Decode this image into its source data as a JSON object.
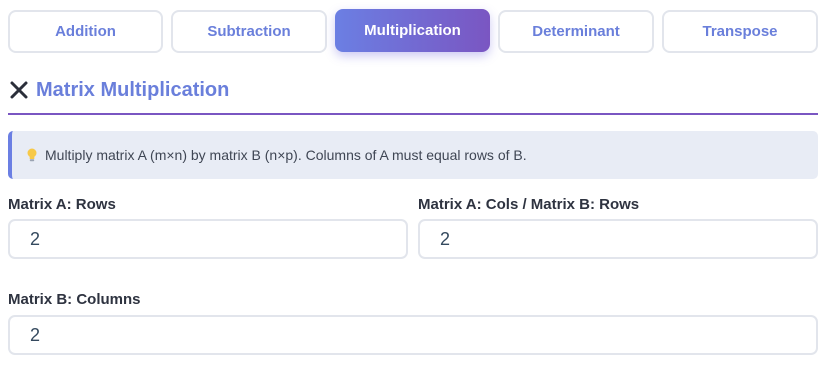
{
  "tabs": [
    {
      "label": "Addition"
    },
    {
      "label": "Subtraction"
    },
    {
      "label": "Multiplication"
    },
    {
      "label": "Determinant"
    },
    {
      "label": "Transpose"
    }
  ],
  "active_tab": "Multiplication",
  "section": {
    "title": "Matrix Multiplication",
    "close_icon": "close-icon"
  },
  "info": {
    "icon": "lightbulb-icon",
    "text": "Multiply matrix A (m×n) by matrix B (n×p). Columns of A must equal rows of B."
  },
  "fields": {
    "a_rows": {
      "label": "Matrix A: Rows",
      "value": "2"
    },
    "a_cols_b_rows": {
      "label": "Matrix A: Cols / Matrix B: Rows",
      "value": "2"
    },
    "b_cols": {
      "label": "Matrix B: Columns",
      "value": "2"
    }
  },
  "colors": {
    "accent": "#6a7fdb",
    "accent_purple": "#7a56c2",
    "info_bg": "#e8ecf5"
  }
}
